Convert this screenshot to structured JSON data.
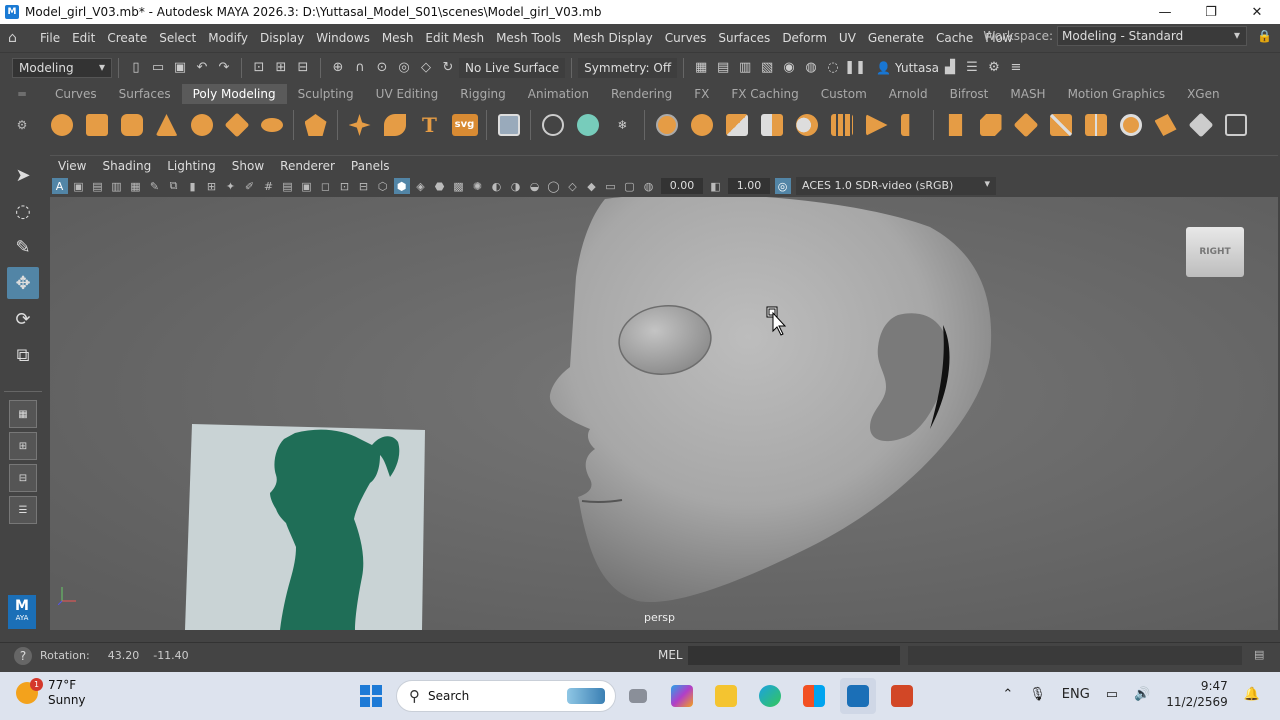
{
  "window": {
    "title": "Model_girl_V03.mb* - Autodesk MAYA 2026.3: D:\\Yuttasal_Model_S01\\scenes\\Model_girl_V03.mb",
    "minimize": "—",
    "maximize": "❐",
    "close": "✕"
  },
  "menu": [
    "File",
    "Edit",
    "Create",
    "Select",
    "Modify",
    "Display",
    "Windows",
    "Mesh",
    "Edit Mesh",
    "Mesh Tools",
    "Mesh Display",
    "Curves",
    "Surfaces",
    "Deform",
    "UV",
    "Generate",
    "Cache",
    "Flow"
  ],
  "workspace": {
    "label": "Workspace:",
    "value": "Modeling - Standard"
  },
  "statusline": {
    "mode": "Modeling",
    "live_surface": "No Live Surface",
    "symmetry": "Symmetry: Off",
    "user": "Yuttasa"
  },
  "shelf_tabs": [
    "Curves",
    "Surfaces",
    "Poly Modeling",
    "Sculpting",
    "UV Editing",
    "Rigging",
    "Animation",
    "Rendering",
    "FX",
    "FX Caching",
    "Custom",
    "Arnold",
    "Bifrost",
    "MASH",
    "Motion Graphics",
    "XGen"
  ],
  "shelf_tab_active": "Poly Modeling",
  "shelf": {
    "text_tool": "T",
    "svg_tool": "svg"
  },
  "panel_menu": [
    "View",
    "Shading",
    "Lighting",
    "Show",
    "Renderer",
    "Panels"
  ],
  "panel_toolbar": {
    "exposure": "0.00",
    "gamma": "1.00",
    "colorspace": "ACES 1.0 SDR-video (sRGB)"
  },
  "viewport": {
    "camera": "persp",
    "viewcube": "RIGHT"
  },
  "toolbox": {
    "logo": "M",
    "logo_sub": "AYA"
  },
  "cmdline": {
    "rotation_label": "Rotation:",
    "rot_x": "43.20",
    "rot_y": "-11.40",
    "lang": "MEL"
  },
  "taskbar": {
    "weather_temp": "77°F",
    "weather_desc": "Sunny",
    "weather_badge": "1",
    "search_placeholder": "Search",
    "lang": "ENG",
    "time": "9:47",
    "date": "11/2/2569"
  },
  "colors": {
    "accent": "#5285a6",
    "shelf_orange": "#e59c45",
    "viewport_bg": "#6b6b6b"
  }
}
